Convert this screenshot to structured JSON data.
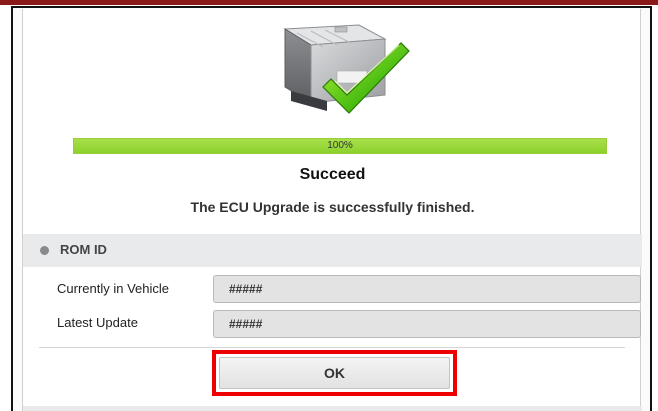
{
  "progress": {
    "percent": 100,
    "label": "100%"
  },
  "status": {
    "title": "Succeed",
    "message": "The ECU Upgrade is successfully finished."
  },
  "rom_id": {
    "section_title": "ROM ID",
    "fields": [
      {
        "label": "Currently in Vehicle",
        "value": "#####"
      },
      {
        "label": "Latest Update",
        "value": "#####"
      }
    ]
  },
  "actions": {
    "ok_label": "OK"
  },
  "colors": {
    "progress_fill": "#8cd12c",
    "highlight": "#ee0000",
    "section_header": "#e9eaec"
  },
  "icons": {
    "illustration": "ecu-module-with-checkmark-icon"
  }
}
